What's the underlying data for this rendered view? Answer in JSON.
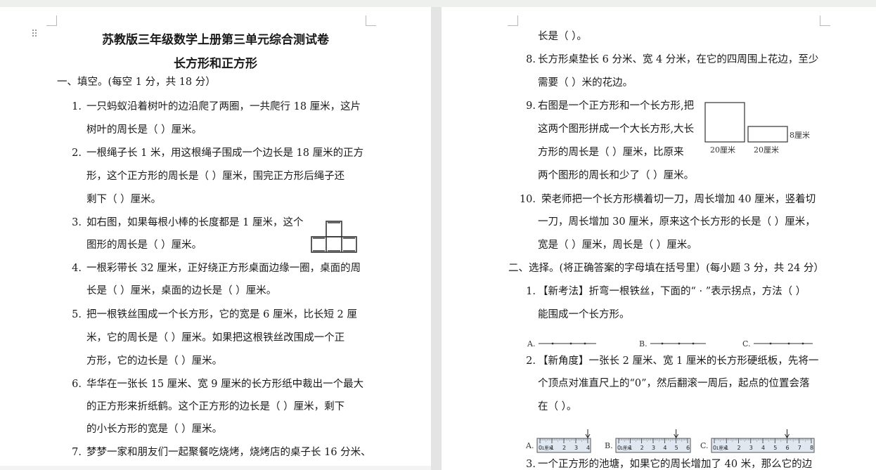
{
  "left_page": {
    "title1": "苏教版三年级数学上册第三单元综合测试卷",
    "title2": "长方形和正方形",
    "section1": "一、填空。(每空 1 分，共 18 分）",
    "q1": {
      "num": "1.",
      "l1": "一只蚂蚁沿着树叶的边沿爬了两圈，一共爬行 18 厘米，这片",
      "l2": "树叶的周长是（      ）厘米。"
    },
    "q2": {
      "num": "2.",
      "l1": "一根绳子长 1 米，用这根绳子围成一个边长是 18 厘米的正方",
      "l2": "形，这个正方形的周长是（      ）厘米，围完正方形后绳子还",
      "l3": "剩下（      ）厘米。"
    },
    "q3": {
      "num": "3.",
      "l1": "如右图，如果每根小棒的长度都是 1 厘米，这个",
      "l2": "图形的周长是（      ）厘米。"
    },
    "q4": {
      "num": "4.",
      "l1": "一根彩带长 32 厘米，正好绕正方形桌面边缘一圈，桌面的周",
      "l2": "长是（      ）厘米，桌面的边长是（      ）厘米。"
    },
    "q5": {
      "num": "5.",
      "l1": "把一根铁丝围成一个长方形，它的宽是 6  厘米，比长短 2  厘",
      "l2": "米，它的周长是（      ）厘米。如果把这根铁丝改围成一个正",
      "l3": "方形，它的边长是（      ）厘米。"
    },
    "q6": {
      "num": "6.",
      "l1": "华华在一张长 15 厘米、宽 9 厘米的长方形纸中裁出一个最大",
      "l2": "的正方形来折纸鹤。这个正方形的边长是（      ）厘米，剩下",
      "l3": "的小长方形的宽是（      ）厘米。"
    },
    "q7": {
      "num": "7.",
      "l1": "梦梦一家和朋友们一起聚餐吃烧烤，烧烤店的桌子长 16 分米、"
    }
  },
  "right_page": {
    "q7_cont": "长是（            ）。",
    "q8": {
      "num": "8.",
      "l1": "长方形桌垫长 6 分米、宽 4 分米，在它的四周围上花边，至少",
      "l2": "需要（      ）米的花边。"
    },
    "q9": {
      "num": "9.",
      "l1": "右图是一个正方形和一个长方形,把",
      "l2": "这两个图形拼成一个大长方形,大长",
      "l3": "方形的周长是（      ）厘米，比原来",
      "l4": "两个图形的周长和少了（      ）厘米。",
      "fig": {
        "w1": "20厘米",
        "w2": "20厘米",
        "h": "8厘米"
      }
    },
    "q10": {
      "num": "10.",
      "l1": "荣老师把一个长方形横着切一刀，周长增加 40 厘米，竖着切",
      "l2": "一刀，周长增加 30 厘米，原来这个长方形的长是（      ）厘米，",
      "l3": "宽是（      ）厘米，周长是（      ）厘米。"
    },
    "section2": "二、选择。(将正确答案的字母填在括号里）(每小题 3 分，共 24 分）",
    "s1": {
      "num": "1.",
      "l1": "【新考法】折弯一根铁丝，下面的“  ·  ”表示拐点，方法（      ）",
      "l2": "能围成一个长方形。",
      "opts": [
        "A.",
        "B.",
        "C."
      ]
    },
    "s2": {
      "num": "2.",
      "l1": "【新角度】一张长 2 厘米、宽 1 厘米的长方形硬纸板，先将一",
      "l2": "个顶点对准直尺上的“0”，然后翻滚一周后，起点的位置会落",
      "l3": "在（      ）。",
      "opts": [
        "A.",
        "B.",
        "C."
      ],
      "ruler_label": "1厘米",
      "ruler_ticks_a": [
        "0",
        "1",
        "2",
        "3",
        "4"
      ],
      "ruler_ticks_b": [
        "0",
        "1",
        "2",
        "3",
        "4",
        "5",
        "6"
      ],
      "ruler_ticks_c": [
        "0",
        "1",
        "2",
        "3",
        "4",
        "5",
        "6",
        "7",
        "8"
      ]
    },
    "s3": {
      "num": "3.",
      "l1": "一个正方形的池塘，如果它的周长增加了 40 米，那么它的边"
    }
  }
}
